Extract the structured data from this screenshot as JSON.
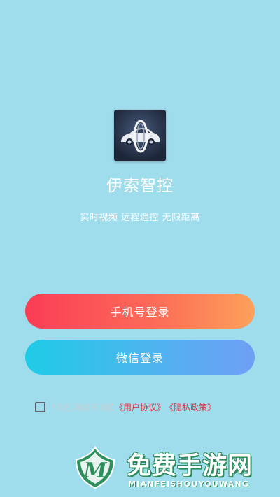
{
  "app": {
    "name": "伊索智控",
    "tagline": "实时视频  远程遥控  无限距离",
    "logo_icon": "car-ring-logo-icon"
  },
  "login": {
    "phone_button_label": "手机号登录",
    "wechat_button_label": "微信登录"
  },
  "agreement": {
    "prefix": "*我已阅读并同意",
    "user_agreement_link": "《用户协议》",
    "privacy_policy_link": "《隐私政策》",
    "checked": false
  },
  "watermark": {
    "title": "免费手游网",
    "subtitle": "MIANFEISHOUYOUWANG",
    "logo_letter": "M"
  },
  "colors": {
    "background": "#9fdcec",
    "phone_button_start": "#fb3d55",
    "phone_button_end": "#fda15b",
    "wechat_button_start": "#1fcbe6",
    "wechat_button_end": "#6f9ff5",
    "link": "#e0343f"
  }
}
